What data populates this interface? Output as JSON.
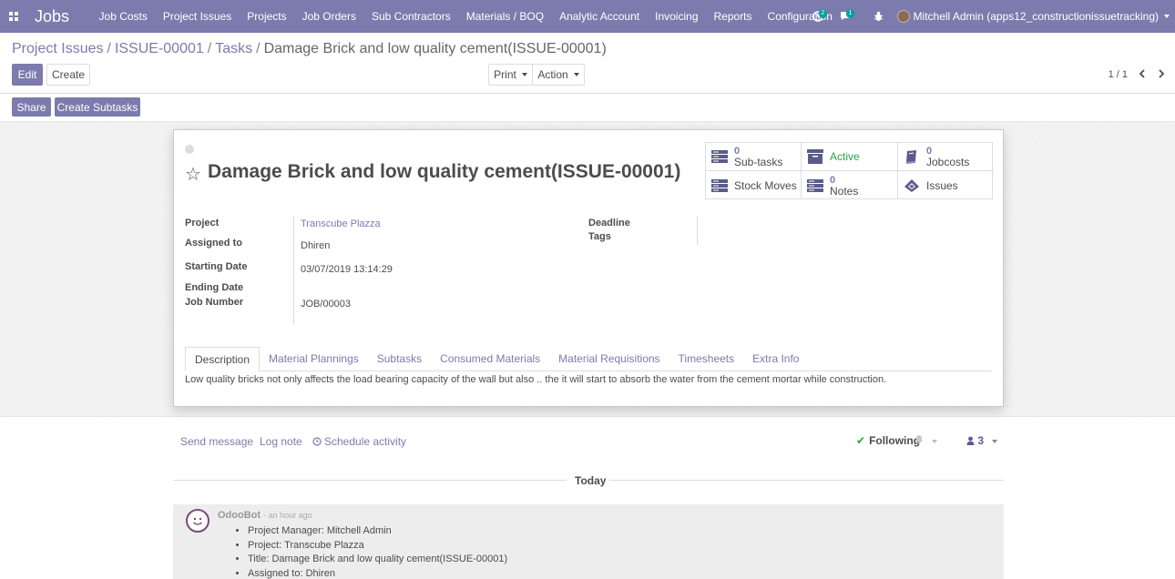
{
  "navbar": {
    "brand": "Jobs",
    "menu": [
      "Job Costs",
      "Project Issues",
      "Projects",
      "Job Orders",
      "Sub Contractors",
      "Materials / BOQ",
      "Analytic Account",
      "Invoicing",
      "Reports",
      "Configuration"
    ],
    "activity_count": "2",
    "messages_count": "1",
    "user": "Mitchell Admin (apps12_constructionissuetracking)"
  },
  "breadcrumb": {
    "items": [
      "Project Issues",
      "ISSUE-00001",
      "Tasks"
    ],
    "current": "Damage Brick and low quality cement(ISSUE-00001)"
  },
  "buttons": {
    "edit": "Edit",
    "create": "Create",
    "print": "Print",
    "action": "Action",
    "share": "Share",
    "create_subtasks": "Create Subtasks"
  },
  "pager": "1 / 1",
  "form": {
    "title": "Damage Brick and low quality cement(ISSUE-00001)",
    "smart_buttons": {
      "subtasks_count": "0",
      "subtasks_label": "Sub-tasks",
      "active_label": "Active",
      "jobcosts_count": "0",
      "jobcosts_label": "Jobcosts",
      "stock_moves_label": "Stock Moves",
      "notes_count": "0",
      "notes_label": "Notes",
      "issues_label": "Issues"
    },
    "fields": {
      "project_label": "Project",
      "project_value": "Transcube Plazza",
      "assigned_label": "Assigned to",
      "assigned_value": "Dhiren",
      "start_label": "Starting Date",
      "start_value": "03/07/2019 13:14:29",
      "end_label": "Ending Date",
      "job_label": "Job Number",
      "job_value": "JOB/00003",
      "deadline_label": "Deadline",
      "tags_label": "Tags"
    },
    "tabs": [
      "Description",
      "Material Plannings",
      "Subtasks",
      "Consumed Materials",
      "Material Requisitions",
      "Timesheets",
      "Extra Info"
    ],
    "description": "Low quality bricks not only affects the load bearing capacity of the wall but also .. the it will start to absorb the water from the cement mortar while construction."
  },
  "chatter": {
    "send_message": "Send message",
    "log_note": "Log note",
    "schedule_activity": "Schedule activity",
    "following": "Following",
    "followers_count": "3",
    "today": "Today",
    "message": {
      "author": "OdooBot",
      "time": "- an hour ago",
      "lines": [
        "Project Manager: Mitchell Admin",
        "Project: Transcube Plazza",
        "Title: Damage Brick and low quality cement(ISSUE-00001)",
        "Assigned to: Dhiren"
      ]
    }
  }
}
